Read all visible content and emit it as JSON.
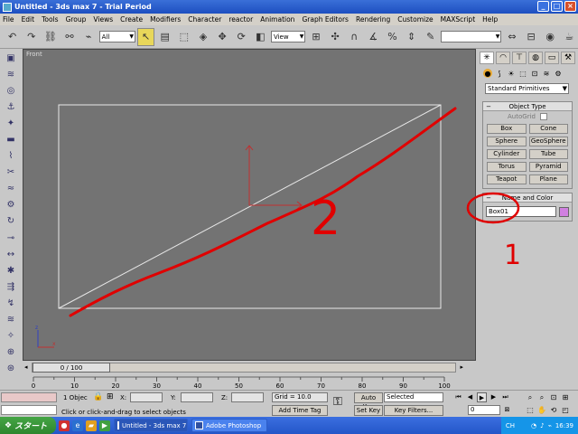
{
  "window": {
    "title": "Untitled - 3ds max 7 - Trial Period",
    "minimize": "_",
    "maximize": "□",
    "close": "×"
  },
  "menu": [
    "File",
    "Edit",
    "Tools",
    "Group",
    "Views",
    "Create",
    "Modifiers",
    "Character",
    "reactor",
    "Animation",
    "Graph Editors",
    "Rendering",
    "Customize",
    "MAXScript",
    "Help"
  ],
  "toolbar": {
    "icons": [
      "undo-icon",
      "redo-icon",
      "select-link-icon",
      "unlink-icon",
      "bind-space-warp-icon"
    ],
    "selection_filter": "All",
    "reference_coord": "View",
    "named_selection": ""
  },
  "viewport": {
    "label": "Front"
  },
  "command_panel": {
    "dropdown": "Standard Primitives",
    "object_type": {
      "title": "Object Type",
      "autogrid": "AutoGrid",
      "buttons": [
        "Box",
        "Cone",
        "Sphere",
        "GeoSphere",
        "Cylinder",
        "Tube",
        "Torus",
        "Pyramid",
        "Teapot",
        "Plane"
      ]
    },
    "name_color": {
      "title": "Name and Color",
      "name": "Box01",
      "color": "#d080e0"
    }
  },
  "timeline": {
    "slider": "0 / 100",
    "ticks": [
      "0",
      "10",
      "20",
      "30",
      "40",
      "50",
      "60",
      "70",
      "80",
      "90",
      "100"
    ]
  },
  "status": {
    "selection": "1 Objec",
    "x_label": "X:",
    "y_label": "Y:",
    "z_label": "Z:",
    "grid": "Grid = 10.0",
    "prompt": "Click or click-and-drag to select objects",
    "add_time_tag": "Add Time Tag",
    "auto_key": "Auto Key",
    "set_key": "Set Key",
    "key_mode": "Selected",
    "key_filters": "Key Filters...",
    "frame": "0"
  },
  "taskbar": {
    "start": "スタート",
    "tasks": [
      {
        "label": "Untitled - 3ds max 7..."
      },
      {
        "label": "Adobe Photoshop"
      }
    ],
    "ime": "CH",
    "clock": "16:39"
  },
  "annotations": {
    "label_1": "1",
    "label_2": "2"
  },
  "colors": {
    "annotation": "#e00000",
    "viewport_bg": "#737373",
    "box_wire": "#e8e8e8"
  }
}
